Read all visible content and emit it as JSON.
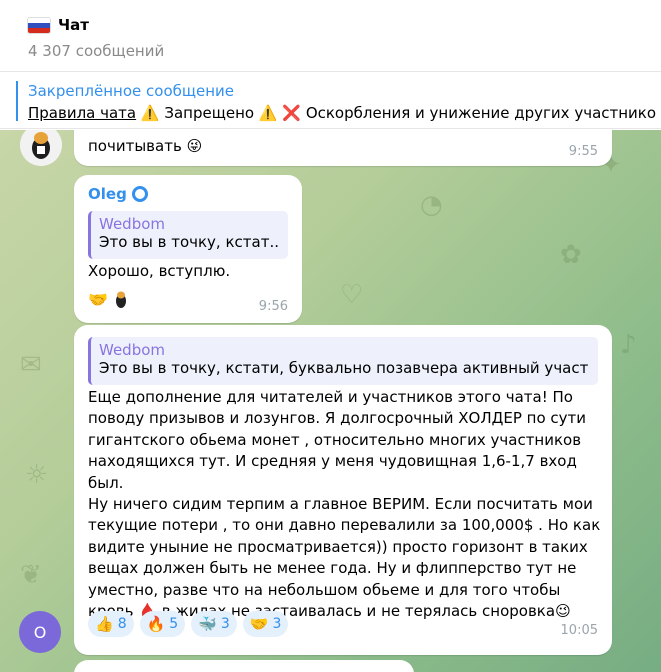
{
  "header": {
    "title": "Чат",
    "subtitle": "4 307 сообщений"
  },
  "pinned": {
    "title": "Закреплённое сообщение",
    "link": "Правила чата",
    "warn1": "⚠️",
    "text1": "Запрещено",
    "warn2": "⚠️",
    "cross": "❌",
    "text2": "Оскорбления и унижение других участнико"
  },
  "messages": [
    {
      "text": "почитывать",
      "emoji": "😜",
      "time": "9:55"
    },
    {
      "sender": "Oleg",
      "reply_name": "Wedbom",
      "reply_text": "Это вы в точку, кстат...",
      "text": "Хорошо, вступлю.",
      "reaction_emoji": "🤝",
      "time": "9:56"
    },
    {
      "reply_name": "Wedbom",
      "reply_text": "Это вы в точку, кстати, буквально позавчера активный участ...",
      "lines": [
        "Еще дополнение для читателей и участников этого чата! По",
        "поводу призывов и лозунгов. Я долгосрочный ХОЛДЕР по сути",
        "гигантского обьема монет , относительно многих участников",
        "находящихся тут. И средняя у меня чудовищная 1,6-1,7 вход был.",
        "Ну ничего сидим терпим а главное ВЕРИМ. Если посчитать мои",
        "текущие потери , то они давно перевалили за 100,000$ . Но как",
        "видите уныние не просматривается)) просто горизонт в таких",
        "вещах должен быть не менее года. Ну и флипперство тут не",
        "уместно, разве что на небольшом обьеме и для того чтобы"
      ],
      "last_line_a": "кровь",
      "drop": "🩸",
      "last_line_b": "в жилах не застаивалась и не терялась сноровка",
      "last_emoji": "😉",
      "reactions": [
        {
          "emoji": "👍",
          "count": "8"
        },
        {
          "emoji": "🔥",
          "count": "5"
        },
        {
          "emoji": "🐳",
          "count": "3"
        },
        {
          "emoji": "🤝",
          "count": "3"
        }
      ],
      "time": "10:05",
      "avatar_letter": "O"
    }
  ],
  "colors": {
    "accent": "#3390ec",
    "reply_accent": "#8774e1",
    "avatar": "#7b68d9"
  }
}
